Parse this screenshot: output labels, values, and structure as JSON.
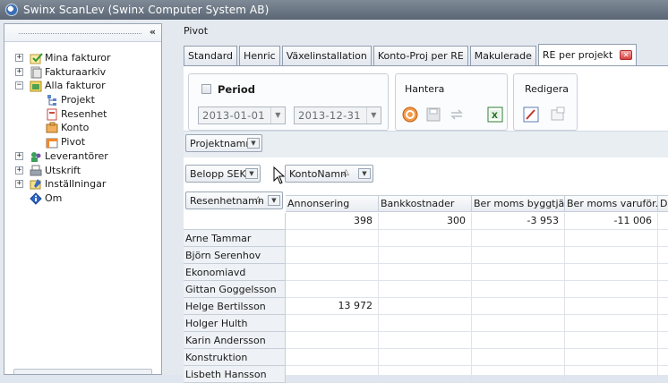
{
  "window": {
    "title": "Swinx ScanLev (Swinx Computer System AB)"
  },
  "sidebar": {
    "collapse_glyph": "«",
    "items": [
      {
        "label": "Mina fakturor",
        "icon": "invoice-check-icon",
        "level": 0,
        "expander": "+"
      },
      {
        "label": "Fakturaarkiv",
        "icon": "archive-icon",
        "level": 0,
        "expander": "+"
      },
      {
        "label": "Alla fakturor",
        "icon": "all-invoices-icon",
        "level": 0,
        "expander": "−"
      },
      {
        "label": "Projekt",
        "icon": "project-icon",
        "level": 1
      },
      {
        "label": "Resenhet",
        "icon": "resource-unit-icon",
        "level": 1
      },
      {
        "label": "Konto",
        "icon": "account-icon",
        "level": 1
      },
      {
        "label": "Pivot",
        "icon": "pivot-icon",
        "level": 1
      },
      {
        "label": "Leverantörer",
        "icon": "suppliers-icon",
        "level": 0,
        "expander": "+"
      },
      {
        "label": "Utskrift",
        "icon": "print-icon",
        "level": 0,
        "expander": "+"
      },
      {
        "label": "Inställningar",
        "icon": "settings-icon",
        "level": 0,
        "expander": "+"
      },
      {
        "label": "Om",
        "icon": "info-icon",
        "level": 0
      }
    ]
  },
  "main": {
    "title": "Pivot",
    "tabs": [
      {
        "label": "Standard"
      },
      {
        "label": "Henric"
      },
      {
        "label": "Växelinstallation"
      },
      {
        "label": "Konto-Proj per RE"
      },
      {
        "label": "Makulerade"
      },
      {
        "label": "RE per projekt",
        "active": true
      }
    ],
    "period": {
      "label": "Period",
      "from": "2013-01-01",
      "to": "2013-12-31"
    },
    "hantera": {
      "label": "Hantera"
    },
    "redigera": {
      "label": "Redigera"
    },
    "filter_field": "Projektnamn",
    "data_field": "Belopp SEK",
    "column_field": "KontoNamn",
    "row_field": "Resenhetnamn",
    "columns": [
      "Annonsering",
      "Bankkostnader",
      "Ber moms byggtjä...",
      "Ber moms varuför...",
      "Da"
    ],
    "totals": [
      "398",
      "300",
      "-3 953",
      "-11 006",
      ""
    ],
    "rows": [
      {
        "name": "Arne Tammar",
        "values": [
          "",
          "",
          "",
          "",
          ""
        ]
      },
      {
        "name": "Björn Serenhov",
        "values": [
          "",
          "",
          "",
          "",
          ""
        ]
      },
      {
        "name": "Ekonomiavd",
        "values": [
          "",
          "",
          "",
          "",
          ""
        ]
      },
      {
        "name": "Gittan Goggelsson",
        "values": [
          "",
          "",
          "",
          "",
          ""
        ]
      },
      {
        "name": "Helge Bertilsson",
        "values": [
          "13 972",
          "",
          "",
          "",
          ""
        ]
      },
      {
        "name": "Holger Hulth",
        "values": [
          "",
          "",
          "",
          "",
          ""
        ]
      },
      {
        "name": "Karin Andersson",
        "values": [
          "",
          "",
          "",
          "",
          ""
        ]
      },
      {
        "name": "Konstruktion",
        "values": [
          "",
          "",
          "",
          "",
          ""
        ]
      },
      {
        "name": "Lisbeth Hansson",
        "values": [
          "",
          "",
          "",
          "",
          ""
        ]
      }
    ]
  }
}
